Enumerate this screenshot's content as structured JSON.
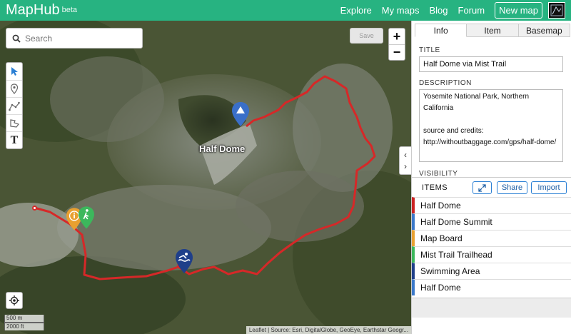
{
  "header": {
    "brand": "MapHub",
    "beta": "beta",
    "nav": [
      "Explore",
      "My maps",
      "Blog",
      "Forum"
    ],
    "new_map": "New map"
  },
  "map": {
    "search_placeholder": "Search",
    "save": "Save",
    "zoom_in": "+",
    "zoom_out": "−",
    "label": "Half Dome",
    "scale_metric": "500 m",
    "scale_imperial": "2000 ft",
    "attribution": "Leaflet | Source: Esri, DigitalGlobe, GeoEye, Earthstar Geogr...",
    "tools": [
      "cursor-icon",
      "marker-icon",
      "line-icon",
      "polygon-icon",
      "text-icon"
    ],
    "collapse_left": "‹",
    "collapse_right": "›"
  },
  "panel": {
    "tabs": [
      "Info",
      "Item",
      "Basemap"
    ],
    "active_tab": "Info",
    "title_label": "TITLE",
    "title_value": "Half Dome via Mist Trail",
    "description_label": "DESCRIPTION",
    "description_value": "Yosemite National Park, Northern California\n\nsource and credits:\nhttp://withoutbaggage.com/gps/half-dome/",
    "visibility_label": "VISIBILITY",
    "items_label": "ITEMS",
    "share": "Share",
    "import": "Import",
    "items": [
      {
        "name": "Half Dome",
        "color": "#cc2222"
      },
      {
        "name": "Half Dome Summit",
        "color": "#3a78c9"
      },
      {
        "name": "Map Board",
        "color": "#e8a030"
      },
      {
        "name": "Mist Trail Trailhead",
        "color": "#3cb85c"
      },
      {
        "name": "Swimming Area",
        "color": "#1f3f8a"
      },
      {
        "name": "Half Dome",
        "color": "#3a78c9"
      }
    ]
  },
  "colors": {
    "brand": "#27b381",
    "trail": "#d62828",
    "marker_blue": "#3a6fc9",
    "marker_orange": "#e8a030",
    "marker_green": "#3cb85c",
    "marker_navy": "#1f3f8a"
  }
}
